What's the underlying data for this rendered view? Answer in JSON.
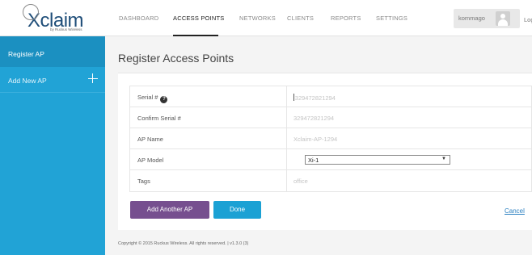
{
  "header": {
    "logo_text": "Xclaim",
    "logo_sub": "by Ruckus Wireless",
    "nav": [
      {
        "label": "DASHBOARD",
        "active": false
      },
      {
        "label": "ACCESS POINTS",
        "active": true
      },
      {
        "label": "NETWORKS",
        "active": false
      },
      {
        "label": "CLIENTS",
        "active": false
      },
      {
        "label": "REPORTS",
        "active": false
      },
      {
        "label": "SETTINGS",
        "active": false
      }
    ],
    "username": "kommago",
    "logout": "Logo"
  },
  "sidebar": {
    "title": "Register AP",
    "add_label": "Add New AP"
  },
  "main": {
    "title": "Register Access Points",
    "form": {
      "serial": {
        "label": "Serial #",
        "placeholder": "329472821294"
      },
      "confirm_serial": {
        "label": "Confirm Serial #",
        "placeholder": "329472821294"
      },
      "ap_name": {
        "label": "AP Name",
        "placeholder": "Xclaim-AP-1294"
      },
      "ap_model": {
        "label": "AP Model",
        "value": "Xi-1"
      },
      "tags": {
        "label": "Tags",
        "placeholder": "office"
      }
    },
    "add_another_label": "Add Another AP",
    "done_label": "Done",
    "cancel_label": "Cancel"
  },
  "footer": {
    "text": "Copyright © 2015 Ruckus Wireless. All rights reserved. | v1.3.0 (3)"
  },
  "colors": {
    "sidebar": "#21a3d6",
    "sidebar_title": "#1b90c1",
    "add_button": "#764f8f",
    "done_button": "#1ba1d4",
    "link": "#2a7fc0"
  }
}
